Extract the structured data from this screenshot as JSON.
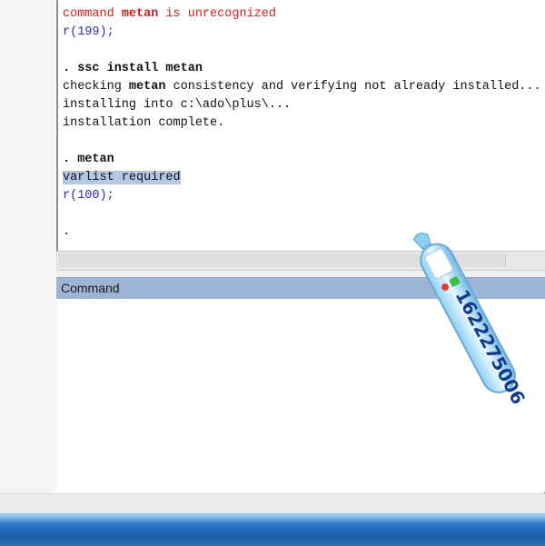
{
  "results": {
    "lines": [
      {
        "parts": [
          {
            "text": "command ",
            "cls": "err"
          },
          {
            "text": "metan",
            "cls": "err b"
          },
          {
            "text": " is unrecognized",
            "cls": "err"
          }
        ]
      },
      {
        "parts": [
          {
            "text": "r(199);",
            "cls": "rc"
          }
        ]
      },
      {
        "parts": [
          {
            "text": "",
            "cls": ""
          }
        ]
      },
      {
        "parts": [
          {
            "text": ". ssc install metan",
            "cls": "b"
          }
        ]
      },
      {
        "parts": [
          {
            "text": "checking ",
            "cls": ""
          },
          {
            "text": "metan",
            "cls": "b"
          },
          {
            "text": " consistency and verifying not already installed...",
            "cls": ""
          }
        ]
      },
      {
        "parts": [
          {
            "text": "installing into c:\\ado\\plus\\...",
            "cls": ""
          }
        ]
      },
      {
        "parts": [
          {
            "text": "installation complete.",
            "cls": ""
          }
        ]
      },
      {
        "parts": [
          {
            "text": "",
            "cls": ""
          }
        ]
      },
      {
        "parts": [
          {
            "text": ". metan",
            "cls": "b"
          }
        ]
      },
      {
        "parts": [
          {
            "text": "varlist required",
            "cls": "hl"
          }
        ]
      },
      {
        "parts": [
          {
            "text": "r(100);",
            "cls": "rc"
          }
        ]
      },
      {
        "parts": [
          {
            "text": "",
            "cls": ""
          }
        ]
      },
      {
        "parts": [
          {
            "text": ".",
            "cls": ""
          }
        ]
      }
    ]
  },
  "command": {
    "title": "Command",
    "value": ""
  },
  "watermark": {
    "number": "1622275006"
  },
  "colors": {
    "error": "#d41e1e",
    "return_code": "#2a2ab0",
    "highlight": "#b3c8e4",
    "command_header": "#9db5d4"
  }
}
